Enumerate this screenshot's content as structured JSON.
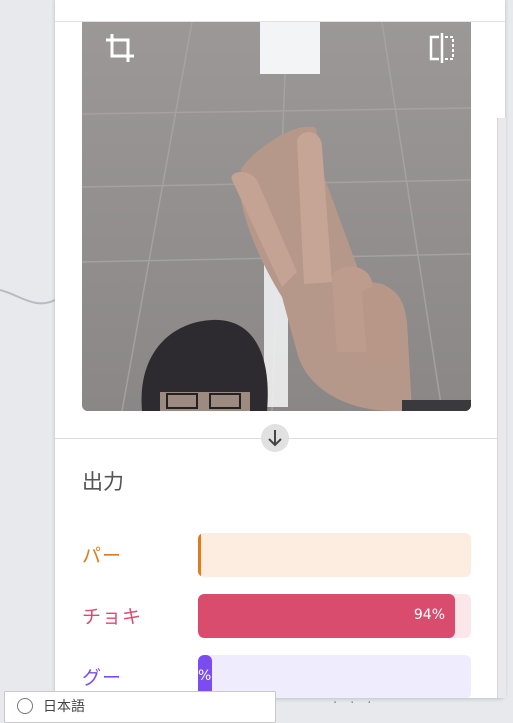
{
  "preview": {
    "crop_icon": "crop-icon",
    "flip_icon": "flip-horizontal-icon"
  },
  "arrow_icon": "arrow-down-icon",
  "output": {
    "title": "出力",
    "classes": [
      {
        "label": "パー",
        "confidence": 0.01,
        "pct_label": "",
        "color": "#e07b1a",
        "track": "#fdece0"
      },
      {
        "label": "チョキ",
        "confidence": 0.94,
        "pct_label": "94%",
        "color": "#d94c6e",
        "track": "#fbe6ea"
      },
      {
        "label": "グー",
        "confidence": 0.05,
        "pct_label": "%",
        "color": "#7b4cf0",
        "track": "#efecfd"
      }
    ]
  },
  "language": {
    "icon": "globe-icon",
    "label": "日本語"
  },
  "footer_links": "　·　·　·"
}
